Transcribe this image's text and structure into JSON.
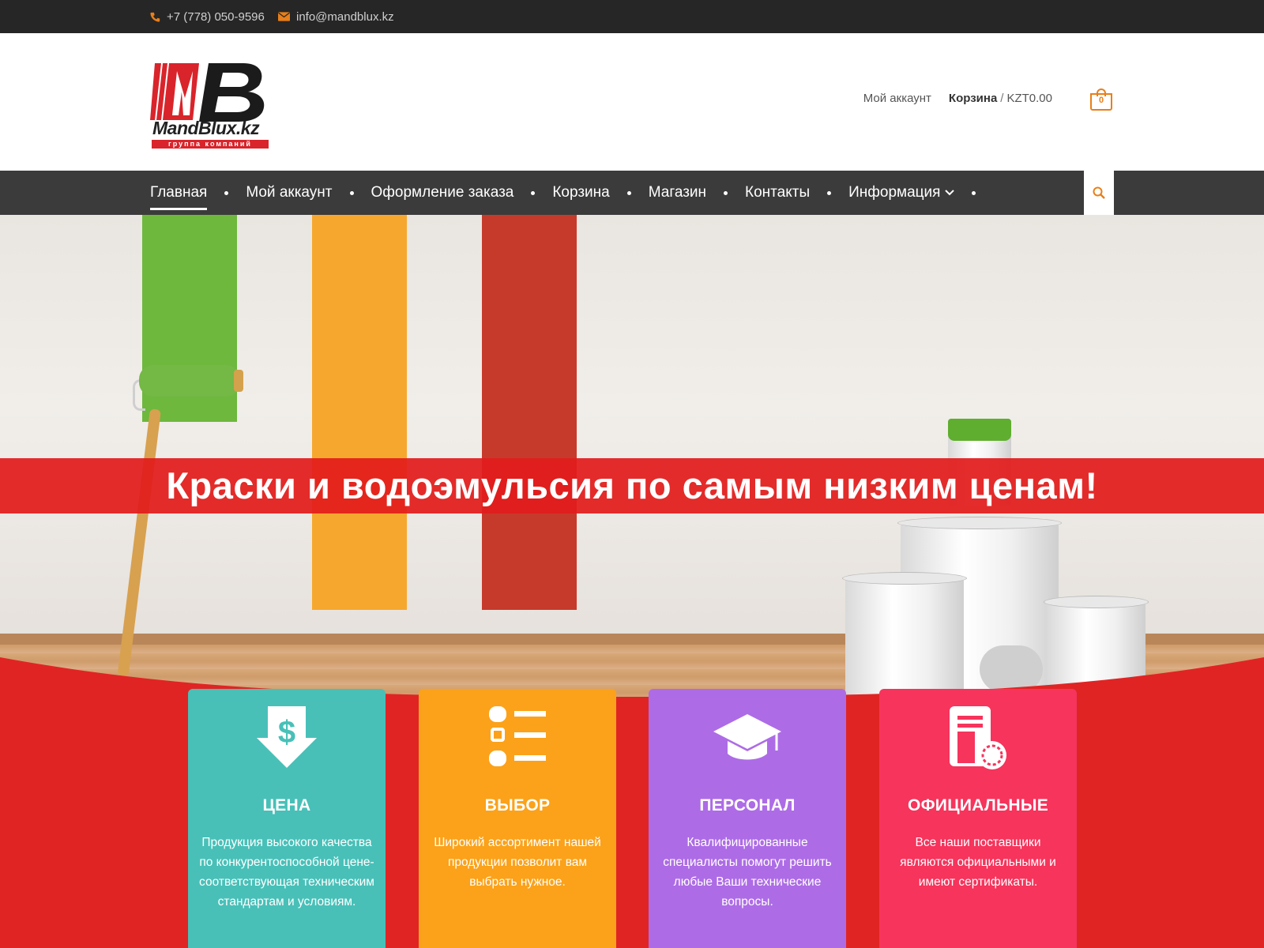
{
  "topbar": {
    "phone": "+7 (778) 050-9596",
    "email": "info@mandblux.kz"
  },
  "logo": {
    "name": "MandBlux.kz",
    "subtitle": "группа компаний"
  },
  "header": {
    "account_label": "Мой аккаунт",
    "cart_label": "Корзина",
    "cart_separator": "/",
    "cart_total": "KZT0.00",
    "cart_count": "0"
  },
  "nav": {
    "items": [
      {
        "label": "Главная",
        "active": true
      },
      {
        "label": "Мой аккаунт"
      },
      {
        "label": "Оформление заказа"
      },
      {
        "label": "Корзина"
      },
      {
        "label": "Магазин"
      },
      {
        "label": "Контакты"
      },
      {
        "label": "Информация",
        "has_dropdown": true
      }
    ],
    "search_icon": "search-icon"
  },
  "hero": {
    "banner_text": "Краски и водоэмульсия по самым низким ценам!"
  },
  "features": [
    {
      "icon": "dollar-arrow-down-icon",
      "title": "ЦЕНА",
      "description": "Продукция высокого качества по конкурентоспособной цене- соответствующая техническим стандартам и условиям.",
      "color": "#48c0b8"
    },
    {
      "icon": "list-icon",
      "title": "ВЫБОР",
      "description": "Широкий ассортимент нашей продукции позволит вам выбрать нужное.",
      "color": "#fba21a"
    },
    {
      "icon": "graduation-cap-icon",
      "title": "ПЕРСОНАЛ",
      "description": "Квалифицированные специалисты помогут решить любые Ваши технические вопросы.",
      "color": "#ad6ce6"
    },
    {
      "icon": "certificate-icon",
      "title": "ОФИЦИАЛЬНЫЕ",
      "description": "Все наши поставщики являются официальными и имеют сертификаты.",
      "color": "#f6345c"
    }
  ],
  "colors": {
    "accent": "#e87f1a",
    "banner_red": "#e21c1c",
    "nav_bg": "#3b3b3b",
    "topbar_bg": "#262626"
  }
}
